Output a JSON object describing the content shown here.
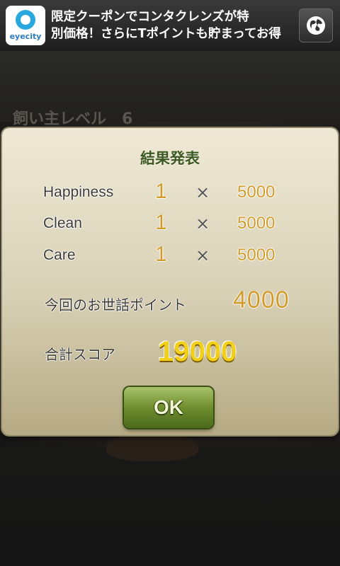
{
  "ad": {
    "logo_text": "eyecity",
    "text_line1": "限定クーポンでコンタクレンズが特",
    "text_line2": "別価格！さらにTポイントも貯まってお得"
  },
  "background": {
    "level_text": "飼い主レベル　6"
  },
  "dialog": {
    "title": "結果発表",
    "rows": [
      {
        "label": "Happiness",
        "count": "1",
        "times": "×",
        "multiplier": "5000"
      },
      {
        "label": "Clean",
        "count": "1",
        "times": "×",
        "multiplier": "5000"
      },
      {
        "label": "Care",
        "count": "1",
        "times": "×",
        "multiplier": "5000"
      }
    ],
    "care_points_label": "今回のお世話ポイント",
    "care_points_value": "4000",
    "total_label": "合計スコア",
    "total_value": "19000",
    "ok_label": "OK"
  },
  "colors": {
    "accent_gold": "#d39a2a",
    "total_yellow": "#f2cf1a",
    "ok_green": "#6f8e2e",
    "title_green": "#3d5a22"
  }
}
